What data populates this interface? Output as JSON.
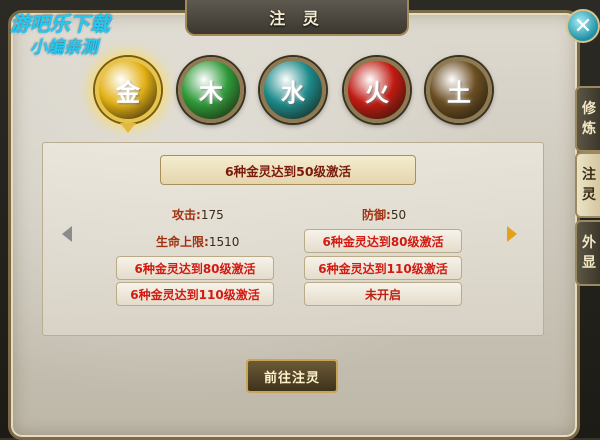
{
  "watermark": {
    "line1": "游吧乐下载",
    "line2": "小编亲测"
  },
  "title": "注 灵",
  "close_label": "✕",
  "elements": [
    {
      "glyph": "金",
      "selected": true,
      "color": "#e3b116"
    },
    {
      "glyph": "木",
      "selected": false,
      "color": "#2f9a3a"
    },
    {
      "glyph": "水",
      "selected": false,
      "color": "#1c8a8a"
    },
    {
      "glyph": "火",
      "selected": false,
      "color": "#c01b12"
    },
    {
      "glyph": "土",
      "selected": false,
      "color": "#6b4e22"
    }
  ],
  "activation_title": "6种金灵达到50级激活",
  "stats": {
    "attack_label": "攻击:",
    "attack_value": "175",
    "defense_label": "防御:",
    "defense_value": "50",
    "hp_label": "生命上限:",
    "hp_value": "1510"
  },
  "conditions": {
    "left": [
      "6种金灵达到80级激活",
      "6种金灵达到110级激活"
    ],
    "right": [
      "6种金灵达到80级激活",
      "6种金灵达到110级激活",
      "未开启"
    ]
  },
  "go_button": "前往注灵",
  "side_tabs": [
    {
      "label": "修\n炼",
      "active": false
    },
    {
      "label": "注\n灵",
      "active": true
    },
    {
      "label": "外\n显",
      "active": false
    }
  ],
  "colors": {
    "accent_gold": "#e6c34a",
    "activation_text": "#7a1b0c",
    "condition_text": "#d11a12"
  }
}
